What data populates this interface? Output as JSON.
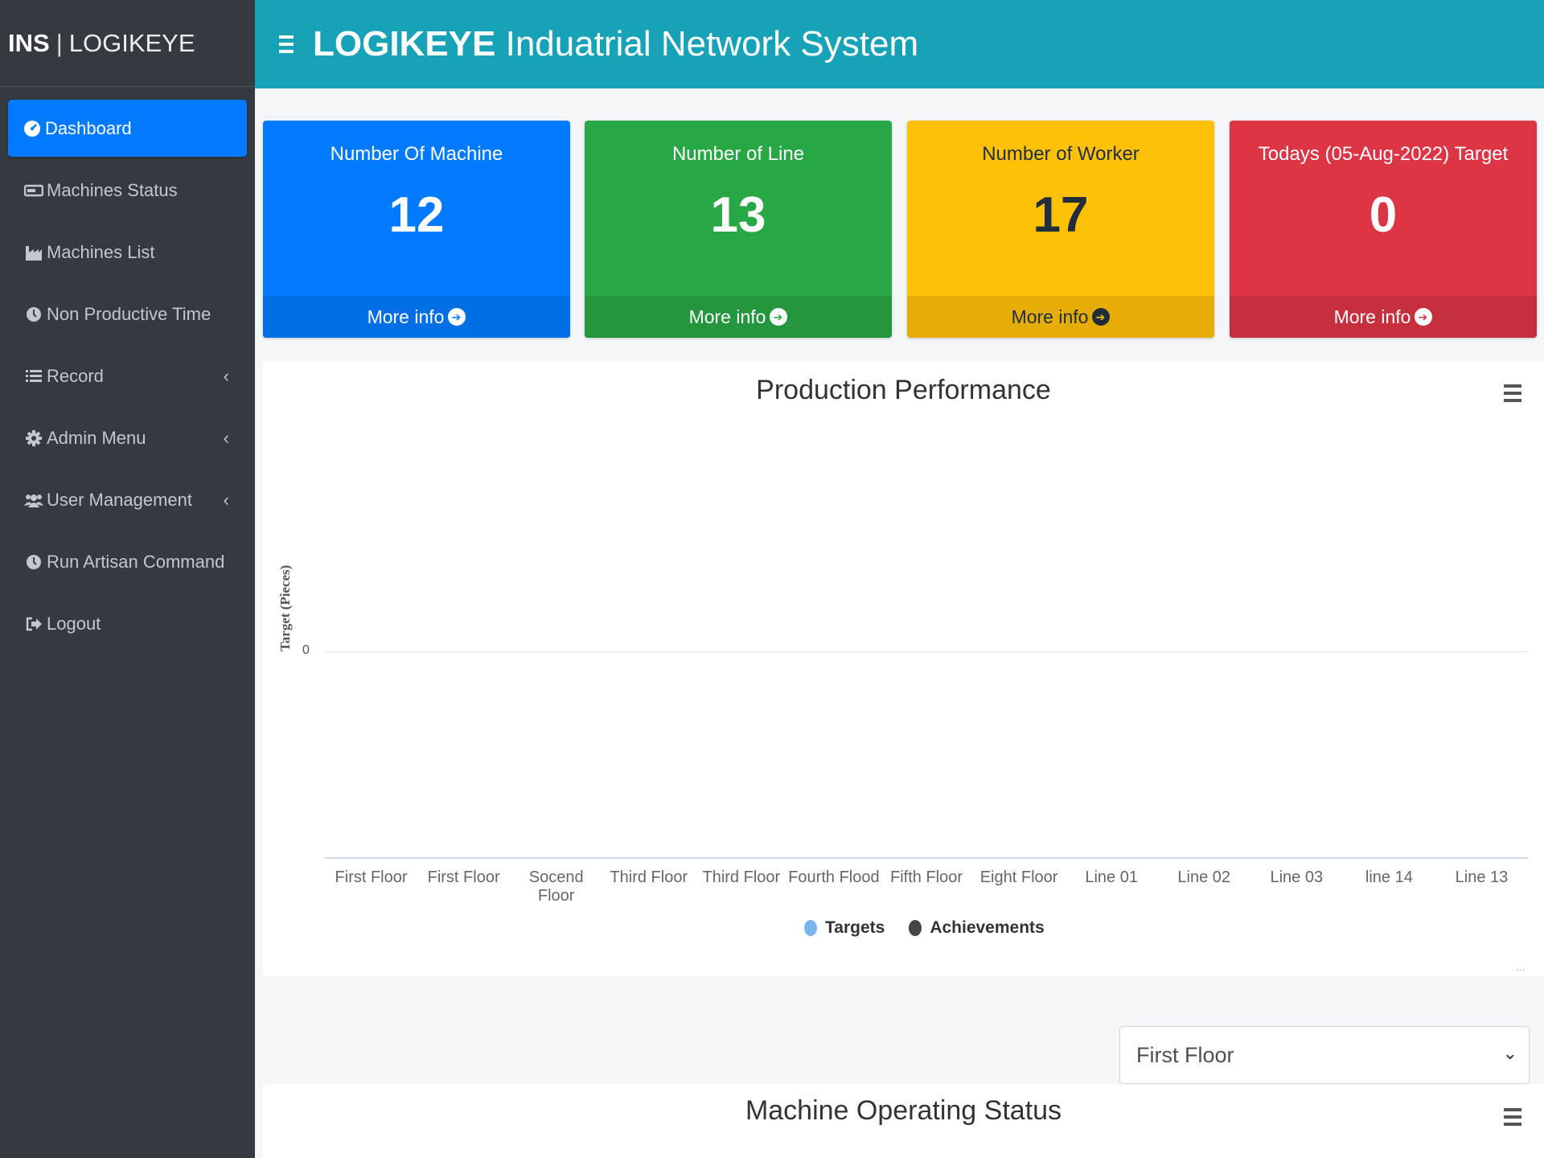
{
  "brand": {
    "short": "INS",
    "name": "LOGIKEYE"
  },
  "header": {
    "title_bold": "LOGIKEYE",
    "title_rest": " Induatrial Network System"
  },
  "sidebar": {
    "items": [
      {
        "label": "Dashboard",
        "icon": "dashboard-icon",
        "active": true
      },
      {
        "label": "Machines Status",
        "icon": "hdd-icon"
      },
      {
        "label": "Machines List",
        "icon": "industry-icon"
      },
      {
        "label": "Non Productive Time",
        "icon": "clock-icon"
      },
      {
        "label": "Record",
        "icon": "list-icon",
        "submenu": true
      },
      {
        "label": "Admin Menu",
        "icon": "cog-icon",
        "submenu": true
      },
      {
        "label": "User Management",
        "icon": "users-icon",
        "submenu": true
      },
      {
        "label": "Run Artisan Command",
        "icon": "clock-icon"
      },
      {
        "label": "Logout",
        "icon": "sign-out-icon"
      }
    ]
  },
  "boxes": [
    {
      "caption": "Number Of Machine",
      "value": "12",
      "more": "More info",
      "color": "#007bff",
      "foot_color": "#006fe6",
      "text_color": "#ffffff"
    },
    {
      "caption": "Number of Line",
      "value": "13",
      "more": "More info",
      "color": "#28a745",
      "foot_color": "#24963e",
      "text_color": "#ffffff"
    },
    {
      "caption": "Number of Worker",
      "value": "17",
      "more": "More info",
      "color": "#ffc107",
      "foot_color": "#e5ad06",
      "text_color": "#1f2d3d"
    },
    {
      "caption": "Todays (05-Aug-2022) Target",
      "value": "0",
      "more": "More info",
      "color": "#dc3545",
      "foot_color": "#c62f3e",
      "text_color": "#ffffff"
    }
  ],
  "chart_data": {
    "type": "bar",
    "title": "Production Performance",
    "ylabel": "Target (Pieces)",
    "xlabel": "",
    "yticks": [
      "0"
    ],
    "categories": [
      "First Floor",
      "First Floor",
      "Socend Floor",
      "Third Floor",
      "Third Floor",
      "Fourth Flood",
      "Fifth Floor",
      "Eight Floor",
      "Line 01",
      "Line 02",
      "Line 03",
      "line 14",
      "Line 13"
    ],
    "series": [
      {
        "name": "Targets",
        "color": "#7cb5ec",
        "values": []
      },
      {
        "name": "Achievements",
        "color": "#434348",
        "values": []
      }
    ],
    "legend_position": "bottom"
  },
  "floor_select": {
    "value": "First Floor"
  },
  "status_card": {
    "title": "Machine Operating Status"
  }
}
